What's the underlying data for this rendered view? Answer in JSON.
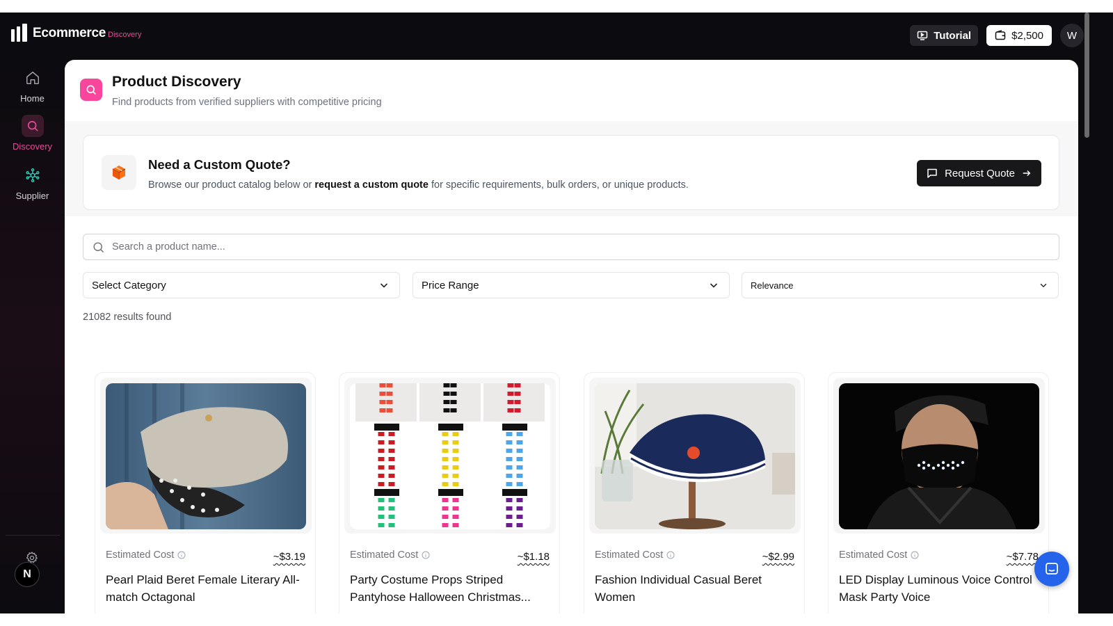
{
  "app": {
    "name": "Ecommerce",
    "sub": "Discovery"
  },
  "topbar": {
    "tutorial_label": "Tutorial",
    "balance": "$2,500",
    "avatar": "W"
  },
  "sidebar": {
    "items": [
      {
        "label": "Home",
        "icon": "home-icon",
        "active": false
      },
      {
        "label": "Discovery",
        "icon": "search-icon",
        "active": true
      },
      {
        "label": "Supplier",
        "icon": "network-icon",
        "active": false
      }
    ],
    "settings_icon": "gear-icon",
    "badge": "N"
  },
  "header": {
    "title": "Product Discovery",
    "subtitle": "Find products from verified suppliers with competitive pricing"
  },
  "quote": {
    "title": "Need a Custom Quote?",
    "text_before": "Browse our product catalog below or ",
    "text_bold": "request a custom quote",
    "text_after": " for specific requirements, bulk orders, or unique products.",
    "button": "Request Quote"
  },
  "search": {
    "placeholder": "Search a product name..."
  },
  "filters": {
    "category": "Select Category",
    "price": "Price Range",
    "sort": "Relevance"
  },
  "results_text": "21082 results found",
  "products": [
    {
      "estimated_label": "Estimated Cost",
      "price": "~$3.19",
      "title": "Pearl Plaid Beret Female Literary All-match Octagonal"
    },
    {
      "estimated_label": "Estimated Cost",
      "price": "~$1.18",
      "title": "Party Costume Props Striped Pantyhose Halloween Christmas..."
    },
    {
      "estimated_label": "Estimated Cost",
      "price": "~$2.99",
      "title": "Fashion Individual Casual Beret Women"
    },
    {
      "estimated_label": "Estimated Cost",
      "price": "~$7.78",
      "title": "LED Display Luminous Voice Control Mask Party Voice"
    }
  ],
  "colors": {
    "accent": "#ec4899",
    "dark": "#0c0b0f",
    "chat": "#2563eb"
  }
}
